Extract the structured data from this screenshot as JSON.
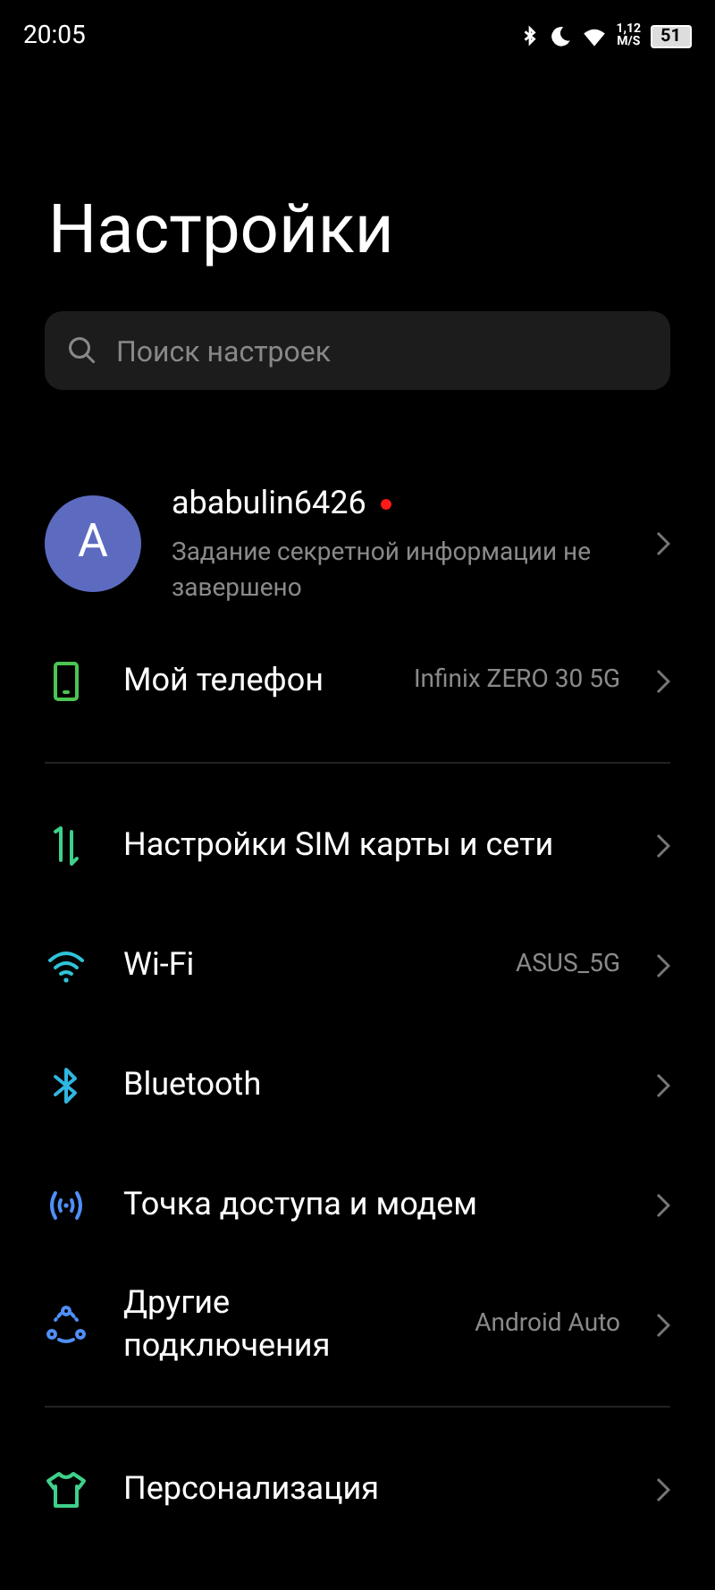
{
  "status_bar": {
    "time": "20:05",
    "speed": "1,12",
    "speed_unit": "M/S",
    "battery": "51"
  },
  "title": "Настройки",
  "search": {
    "placeholder": "Поиск настроек"
  },
  "account": {
    "initial": "A",
    "name": "ababulin6426",
    "unread": true,
    "subtitle": "Задание секретной информации не завершено"
  },
  "sections": [
    {
      "items": [
        {
          "kind": "phone",
          "color": "#4cc552",
          "label": "Мой телефон",
          "value": "Infinix ZERO 30 5G"
        }
      ]
    },
    {
      "items": [
        {
          "kind": "sim",
          "color": "#3fd08a",
          "label": "Настройки SIM карты и сети"
        },
        {
          "kind": "wifi",
          "color": "#2fc4d9",
          "label": "Wi-Fi",
          "value": "ASUS_5G"
        },
        {
          "kind": "bluetooth",
          "color": "#2fb6e0",
          "label": "Bluetooth"
        },
        {
          "kind": "hotspot",
          "color": "#4f8ff7",
          "label": "Точка доступа и модем"
        },
        {
          "kind": "connections",
          "color": "#4f8ff7",
          "label": "Другие подключения",
          "value": "Android Auto"
        }
      ]
    },
    {
      "items": [
        {
          "kind": "shirt",
          "color": "#3fd08a",
          "label": "Персонализация"
        }
      ]
    }
  ]
}
